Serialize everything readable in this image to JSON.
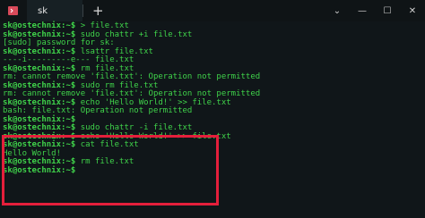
{
  "window": {
    "tab_title": "sk",
    "new_tab_symbol": "+",
    "dropdown_symbol": "⌄",
    "minimize_symbol": "—",
    "maximize_symbol": "☐",
    "close_symbol": "✕"
  },
  "terminal": {
    "lines": [
      {
        "prompt": "sk@ostechnix:~$",
        "text": " > file.txt"
      },
      {
        "prompt": "sk@ostechnix:~$",
        "text": " sudo chattr +i file.txt"
      },
      {
        "prompt": "",
        "text": "[sudo] password for sk:"
      },
      {
        "prompt": "sk@ostechnix:~$",
        "text": " lsattr file.txt"
      },
      {
        "prompt": "",
        "text": "----i---------e--- file.txt"
      },
      {
        "prompt": "sk@ostechnix:~$",
        "text": " rm file.txt"
      },
      {
        "prompt": "",
        "text": "rm: cannot remove 'file.txt': Operation not permitted"
      },
      {
        "prompt": "sk@ostechnix:~$",
        "text": " sudo rm file.txt"
      },
      {
        "prompt": "",
        "text": "rm: cannot remove 'file.txt': Operation not permitted"
      },
      {
        "prompt": "sk@ostechnix:~$",
        "text": " echo 'Hello World!' >> file.txt"
      },
      {
        "prompt": "",
        "text": "bash: file.txt: Operation not permitted"
      },
      {
        "prompt": "sk@ostechnix:~$",
        "text": ""
      },
      {
        "prompt": "sk@ostechnix:~$",
        "text": " sudo chattr -i file.txt"
      },
      {
        "prompt": "sk@ostechnix:~$",
        "text": " echo 'Hello World!' >> file.txt"
      },
      {
        "prompt": "sk@ostechnix:~$",
        "text": " cat file.txt"
      },
      {
        "prompt": "",
        "text": "Hello World!"
      },
      {
        "prompt": "sk@ostechnix:~$",
        "text": " rm file.txt"
      },
      {
        "prompt": "sk@ostechnix:~$",
        "text": ""
      }
    ]
  },
  "colors": {
    "background": "#101619",
    "text": "#3fd24a",
    "highlight_border": "#e41f3b",
    "app_icon": "#d94a5a"
  }
}
